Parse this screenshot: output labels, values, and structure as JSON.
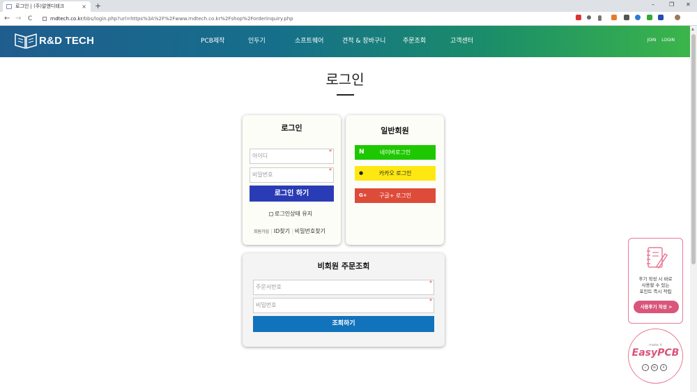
{
  "browser": {
    "tab_title": "로그인 | (주)알앤디테크",
    "tab_close": "×",
    "new_tab": "+",
    "win_min": "–",
    "win_max": "❐",
    "win_close": "✕",
    "back": "←",
    "forward": "→",
    "reload": "C",
    "url_domain": "rndtech.co.kr",
    "url_path": "/bbs/login.php?url=https%3A%2F%2Fwww.rndtech.co.kr%2Fshop%2Forderinquiry.php"
  },
  "header": {
    "logo_text": "R&D TECH",
    "menu": [
      "PCB제작",
      "인두기",
      "소프트웨어",
      "견적 & 장바구니",
      "주문조회",
      "고객센터"
    ],
    "join": "JOIN",
    "login": "LOGIN"
  },
  "page": {
    "title": "로그인"
  },
  "login": {
    "heading": "로그인",
    "id_placeholder": "아이디",
    "pw_placeholder": "비밀번호",
    "required_mark": "*",
    "submit": "로그인 하기",
    "keep_login": "로그인상태 유지",
    "signup": "회원가입",
    "find_id": "ID찾기",
    "find_pw": "비밀번호찾기"
  },
  "social": {
    "heading": "일반회원",
    "naver_icon": "N",
    "naver": "네이버로그인",
    "kakao_icon": "●",
    "kakao": "카카오 로그인",
    "google_icon": "G+",
    "google": "구글+ 로그인"
  },
  "guest": {
    "heading": "비회원 주문조회",
    "order_placeholder": "주문서번호",
    "pw_placeholder": "비밀번호",
    "submit": "조회하기"
  },
  "review_widget": {
    "line1": "후기 작성 시 바로",
    "line2": "사용할 수 있는",
    "line3": "포인트 즉시 적립",
    "button": "사용후기 작성 >"
  },
  "easypcb": {
    "make": "make it",
    "brand": "EasyPCB"
  },
  "colors": {
    "login_button": "#2a3cb5",
    "naver": "#1ec800",
    "kakao": "#ffe812",
    "google": "#dd4b39",
    "guest_button": "#1173bb",
    "accent_pink": "#d9557a"
  }
}
